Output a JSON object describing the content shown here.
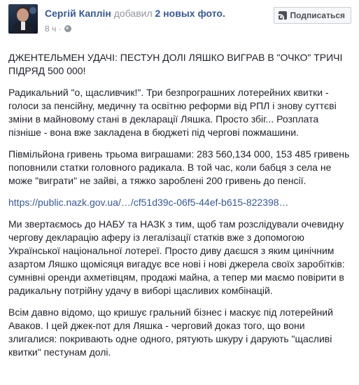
{
  "post": {
    "author": "Сергій Каплін",
    "action": "добавил",
    "photos_text": "2 новых фото.",
    "timestamp": "8 ч",
    "separator": "·",
    "follow_label": "Подписаться",
    "paragraphs": [
      "ДЖЕНТЕЛЬМЕН УДАЧІ: ПЕСТУН ДОЛІ ЛЯШКО ВИГРАВ В \"ОЧКО\" ТРИЧІ ПІДРЯД 500 000!",
      "Радикальний \"о, щасливчик!\". Три безпрограшних лотерейних квитки - голоси за пенсійну, медичну та освітню реформи від РПЛ і знову суттєві зміни в майновому стані в декларації Ляшка. Просто збіг... Розплата пізніше - вона вже закладена в бюджеті під чергові пожмашини.",
      "Півмільйона гривень трьома виграшами: 283 560,134 000, 153 485 гривень поповнили статки головного радикала. В той час, коли бабця з села не може \"виграти\" не зайві, а тяжко зароблені 200 гривень до пенсії."
    ],
    "link": "https://public.nazk.gov.ua/…/cf51d39c-06f5-44ef-b615-822398…",
    "paragraphs_after": [
      "Ми звертаємось до НАБУ та НАЗК з тим, щоб там розслідували очевидну чергову декларацію аферу із легалізації статків вже з допомогою Української національної лотереї. Просто диву даєшся з яким цинічним азартом Ляшко щомісяця вигадує все нові і нові джерела своїх заробітків: сумнівні оренди ахметівцям, продажі майна, а тепер ми маємо повірити в радикальну потрійну удачу в виборі щасливих комбінацій.",
      "Всім давно відомо, що кришує гральний бізнес і маскує під лотерейний Аваков. І цей джек-пот для Ляшка - черговий доказ того, що вони злигалися: покривають одне одного, рятують шкуру і дарують \"щасливі квитки\" пестунам долі."
    ]
  },
  "colors": {
    "link": "#365899",
    "text": "#1d2129",
    "meta": "#90949c",
    "button_bg": "#f6f7f9",
    "button_border": "#ccd0d5"
  },
  "icons": [
    "avatar",
    "globe-icon",
    "rss-icon"
  ]
}
